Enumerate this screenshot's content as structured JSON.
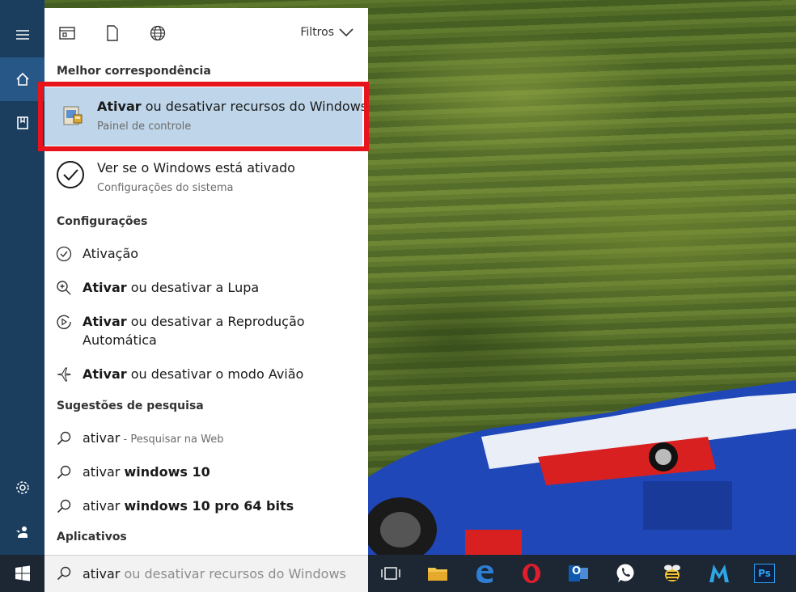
{
  "top_filters": {
    "label": "Filtros"
  },
  "sections": {
    "best": "Melhor correspondência",
    "settings": "Configurações",
    "suggestions": "Sugestões de pesquisa",
    "apps": "Aplicativos"
  },
  "best_match": {
    "title_bold": "Ativar",
    "title_rest": " ou desativar recursos do Windows",
    "subtitle": "Painel de controle"
  },
  "second_match": {
    "title": "Ver se o Windows está ativado",
    "subtitle": "Configurações do sistema"
  },
  "settings_items": [
    {
      "bold": "",
      "rest": "Ativação"
    },
    {
      "bold": "Ativar",
      "rest": " ou desativar a Lupa"
    },
    {
      "bold": "Ativar",
      "rest": " ou desativar a Reprodução",
      "line2": "Automática"
    },
    {
      "bold": "Ativar",
      "rest": " ou desativar o modo Avião"
    }
  ],
  "suggestions": [
    {
      "plain": "ativar",
      "hint": " - Pesquisar na Web",
      "bold": ""
    },
    {
      "plain": "ativar ",
      "hint": "",
      "bold": "windows 10"
    },
    {
      "plain": "ativar ",
      "hint": "",
      "bold": "windows 10 pro 64 bits"
    }
  ],
  "search": {
    "typed": "ativar",
    "completion": " ou desativar recursos do Windows"
  },
  "icons": {
    "rail": [
      "hamburger-icon",
      "home-icon",
      "notebook-icon",
      "settings-gear-icon",
      "feedback-icon"
    ],
    "top": [
      "apps-filter-icon",
      "documents-filter-icon",
      "web-filter-icon"
    ],
    "taskbar": [
      "task-view-icon",
      "file-explorer-icon",
      "edge-icon",
      "opera-icon",
      "outlook-icon",
      "whatsapp-icon",
      "app-bee-icon",
      "filmora-icon",
      "photoshop-icon"
    ]
  },
  "taskbar_labels": {
    "photoshop": "Ps",
    "outlook": "O"
  },
  "colors": {
    "rail": "#1b3e5f",
    "rail_active": "#275786",
    "highlight": "#bfd6ea",
    "red_outline": "#e8141b",
    "taskbar": "#1d2733"
  }
}
